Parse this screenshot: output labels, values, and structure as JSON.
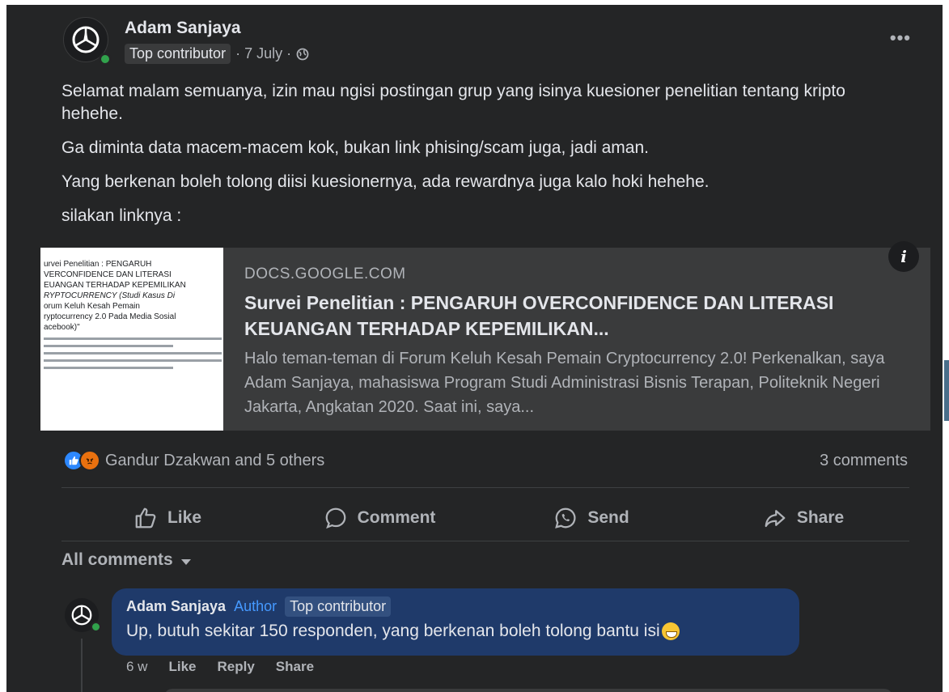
{
  "post": {
    "author": "Adam Sanjaya",
    "badge": "Top contributor",
    "date": "· 7 July ·",
    "more_label": "•••",
    "paragraphs": [
      "Selamat malam semuanya, izin mau ngisi postingan grup yang isinya kuesioner penelitian tentang kripto hehehe.",
      "Ga diminta data macem-macem kok, bukan link phising/scam juga, jadi aman.",
      "Yang berkenan boleh tolong diisi kuesionernya, ada rewardnya juga kalo hoki hehehe.",
      "silakan linknya :"
    ]
  },
  "link_preview": {
    "domain": "DOCS.GOOGLE.COM",
    "title": "Survei Penelitian : PENGARUH OVERCONFIDENCE DAN LITERASI KEUANGAN TERHADAP KEPEMILIKAN...",
    "description": "Halo teman-teman di Forum Keluh Kesah Pemain Cryptocurrency 2.0! Perkenalkan, saya Adam Sanjaya, mahasiswa Program Studi Administrasi Bisnis Terapan, Politeknik Negeri Jakarta, Angkatan 2020. Saat ini, saya...",
    "info_label": "i",
    "thumbnail_lines": [
      "urvei Penelitian : PENGARUH",
      "VERCONFIDENCE DAN LITERASI",
      "EUANGAN TERHADAP KEPEMILIKAN",
      "RYPTOCURRENCY (Studi Kasus Di",
      "orum Keluh Kesah Pemain",
      "ryptocurrency 2.0 Pada Media Sosial",
      "acebook)\""
    ]
  },
  "reactions": {
    "summary": "Gandur Dzakwan and 5 others",
    "comments_count": "3 comments",
    "icons": [
      "like-icon",
      "angry-icon"
    ],
    "like_color": "#2d88ff",
    "angry_color": "#e9710f"
  },
  "actions": {
    "like": "Like",
    "comment": "Comment",
    "send": "Send",
    "share": "Share"
  },
  "comments_section": {
    "filter_label": "All comments",
    "comment": {
      "author": "Adam Sanjaya",
      "author_tag": "Author",
      "badge": "Top contributor",
      "text": "Up, butuh sekitar 150 responden, yang berkenan boleh tolong bantu isi",
      "emoji": "grinning-sweat-emoji",
      "time": "6 w",
      "like": "Like",
      "reply": "Reply",
      "share": "Share"
    }
  }
}
